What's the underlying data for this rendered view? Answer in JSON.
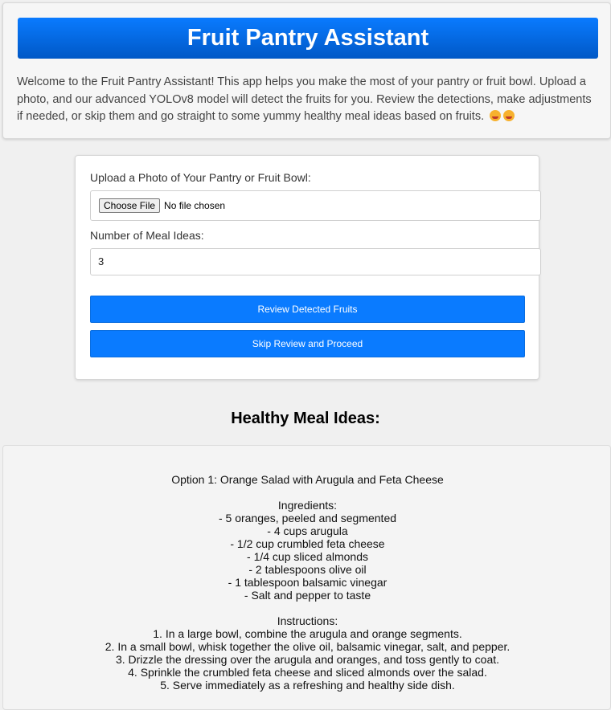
{
  "header": {
    "title": "Fruit Pantry Assistant",
    "intro": "Welcome to the Fruit Pantry Assistant! This app helps you make the most of your pantry or fruit bowl. Upload a photo, and our advanced YOLOv8 model will detect the fruits for you. Review the detections, make adjustments if needed, or skip them and go straight to some yummy healthy meal ideas based on fruits.",
    "emojis": [
      "yum-face-icon",
      "tongue-face-icon"
    ]
  },
  "form": {
    "upload_label": "Upload a Photo of Your Pantry or Fruit Bowl:",
    "file_button": "Choose File",
    "file_status": "No file chosen",
    "meal_count_label": "Number of Meal Ideas:",
    "meal_count_value": "3",
    "review_button": "Review Detected Fruits",
    "skip_button": "Skip Review and Proceed"
  },
  "meals": {
    "title": "Healthy Meal Ideas:",
    "option_title": "Option 1: Orange Salad with Arugula and Feta Cheese",
    "ingredients_heading": "Ingredients:",
    "ingredients": [
      "- 5 oranges, peeled and segmented",
      "- 4 cups arugula",
      "- 1/2 cup crumbled feta cheese",
      "- 1/4 cup sliced almonds",
      "- 2 tablespoons olive oil",
      "- 1 tablespoon balsamic vinegar",
      "- Salt and pepper to taste"
    ],
    "instructions_heading": "Instructions:",
    "instructions": [
      "1. In a large bowl, combine the arugula and orange segments.",
      "2. In a small bowl, whisk together the olive oil, balsamic vinegar, salt, and pepper.",
      "3. Drizzle the dressing over the arugula and oranges, and toss gently to coat.",
      "4. Sprinkle the crumbled feta cheese and sliced almonds over the salad.",
      "5. Serve immediately as a refreshing and healthy side dish."
    ]
  },
  "colors": {
    "accent": "#0a7bff",
    "background": "#f0f0f0"
  }
}
